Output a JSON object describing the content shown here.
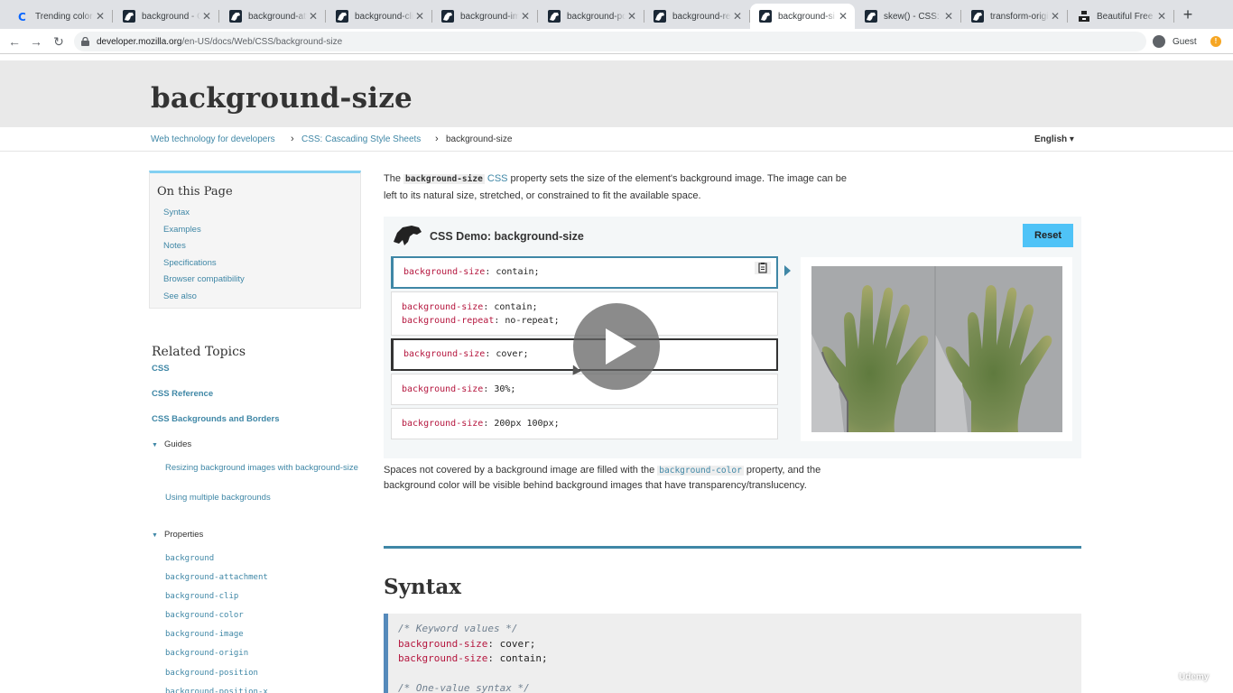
{
  "browser": {
    "tabs": [
      {
        "label": "Trending color p",
        "favicon": "coolors-c-icon"
      },
      {
        "label": "background - C",
        "favicon": "mdn-dino-icon"
      },
      {
        "label": "background-att",
        "favicon": "mdn-dino-icon"
      },
      {
        "label": "background-clip",
        "favicon": "mdn-dino-icon"
      },
      {
        "label": "background-ima",
        "favicon": "mdn-dino-icon"
      },
      {
        "label": "background-po",
        "favicon": "mdn-dino-icon"
      },
      {
        "label": "background-rep",
        "favicon": "mdn-dino-icon"
      },
      {
        "label": "background-si",
        "favicon": "mdn-dino-icon",
        "active": true
      },
      {
        "label": "skew() - CSS: C",
        "favicon": "mdn-dino-icon"
      },
      {
        "label": "transform-origi",
        "favicon": "mdn-dino-icon"
      },
      {
        "label": "Beautiful Free I",
        "favicon": "unsplash-icon"
      }
    ],
    "url_domain": "developer.mozilla.org",
    "url_path": "/en-US/docs/Web/CSS/background-size",
    "profile_label": "Guest"
  },
  "page": {
    "title": "background-size",
    "breadcrumbs": [
      "Web technology for developers",
      "CSS: Cascading Style Sheets",
      "background-size"
    ],
    "language": "English ▾"
  },
  "sidebar": {
    "otp_title": "On this Page",
    "otp_links": [
      "Syntax",
      "Examples",
      "Notes",
      "Specifications",
      "Browser compatibility",
      "See also"
    ],
    "related_title": "Related Topics",
    "related_links": [
      "CSS",
      "CSS Reference",
      "CSS Backgrounds and Borders"
    ],
    "guides_label": "Guides",
    "guides": [
      "Resizing background images with background-size",
      "Using multiple backgrounds"
    ],
    "properties_label": "Properties",
    "properties": [
      "background",
      "background-attachment",
      "background-clip",
      "background-color",
      "background-image",
      "background-origin",
      "background-position",
      "background-position-x"
    ]
  },
  "article": {
    "intro_pre": "The ",
    "intro_code": "background-size",
    "intro_link": "CSS",
    "intro_post": " property sets the size of the element's background image. The image can be left to its natural size, stretched, or constrained to fit the available space.",
    "demo_title": "CSS Demo: background-size",
    "reset_label": "Reset",
    "choices": [
      [
        [
          "background-size",
          "contain;"
        ]
      ],
      [
        [
          "background-size",
          "contain;"
        ],
        [
          "background-repeat",
          "no-repeat;"
        ]
      ],
      [
        [
          "background-size",
          "cover;"
        ]
      ],
      [
        [
          "background-size",
          "30%;"
        ]
      ],
      [
        [
          "background-size",
          "200px 100px;"
        ]
      ]
    ],
    "after_pre": "Spaces not covered by a background image are filled with the ",
    "after_code": "background-color",
    "after_post": " property, and the background color will be visible behind background images that have transparency/translucency.",
    "syntax_heading": "Syntax",
    "syntax_lines": [
      {
        "type": "comment",
        "text": "/* Keyword values */"
      },
      {
        "type": "decl",
        "prop": "background-size",
        "val": "cover;"
      },
      {
        "type": "decl",
        "prop": "background-size",
        "val": "contain;"
      },
      {
        "type": "blank",
        "text": ""
      },
      {
        "type": "comment",
        "text": "/* One-value syntax */"
      }
    ]
  },
  "overlay": {
    "watermark": "Udemy"
  }
}
